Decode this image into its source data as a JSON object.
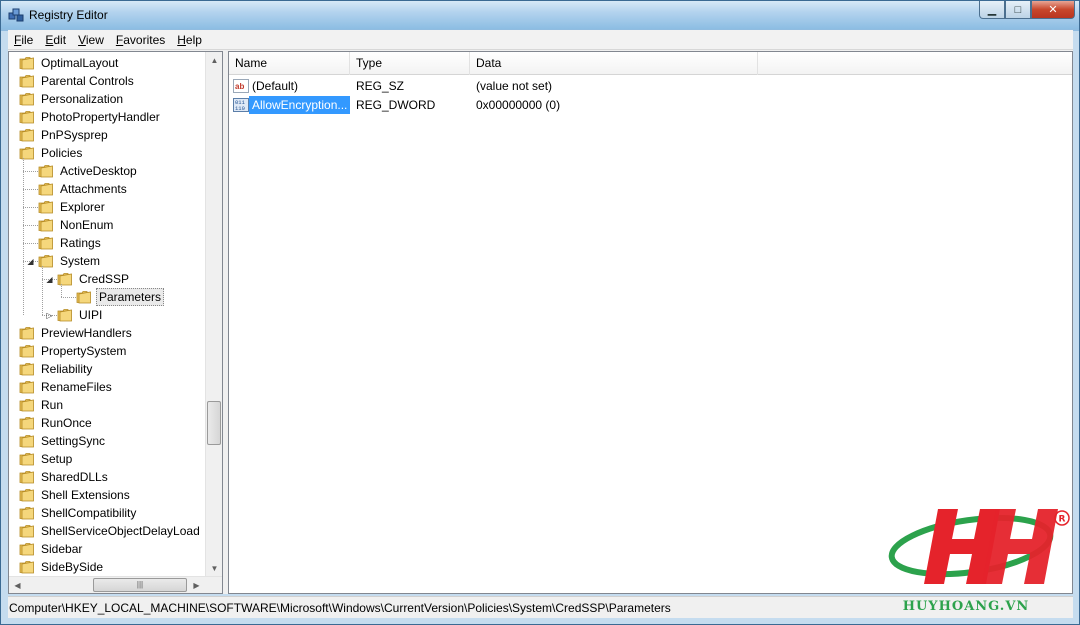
{
  "window": {
    "title": "Registry Editor"
  },
  "menu": [
    "File",
    "Edit",
    "View",
    "Favorites",
    "Help"
  ],
  "tree": [
    {
      "label": "OptimalLayout",
      "level": 0
    },
    {
      "label": "Parental Controls",
      "level": 0
    },
    {
      "label": "Personalization",
      "level": 0
    },
    {
      "label": "PhotoPropertyHandler",
      "level": 0
    },
    {
      "label": "PnPSysprep",
      "level": 0
    },
    {
      "label": "Policies",
      "level": 0
    },
    {
      "label": "ActiveDesktop",
      "level": 1
    },
    {
      "label": "Attachments",
      "level": 1
    },
    {
      "label": "Explorer",
      "level": 1
    },
    {
      "label": "NonEnum",
      "level": 1
    },
    {
      "label": "Ratings",
      "level": 1
    },
    {
      "label": "System",
      "level": 1,
      "expanded": true
    },
    {
      "label": "CredSSP",
      "level": 2,
      "expanded": true
    },
    {
      "label": "Parameters",
      "level": 3,
      "selected": true
    },
    {
      "label": "UIPI",
      "level": 2,
      "collapsed": true
    },
    {
      "label": "PreviewHandlers",
      "level": 0
    },
    {
      "label": "PropertySystem",
      "level": 0
    },
    {
      "label": "Reliability",
      "level": 0
    },
    {
      "label": "RenameFiles",
      "level": 0
    },
    {
      "label": "Run",
      "level": 0
    },
    {
      "label": "RunOnce",
      "level": 0
    },
    {
      "label": "SettingSync",
      "level": 0
    },
    {
      "label": "Setup",
      "level": 0
    },
    {
      "label": "SharedDLLs",
      "level": 0
    },
    {
      "label": "Shell Extensions",
      "level": 0
    },
    {
      "label": "ShellCompatibility",
      "level": 0
    },
    {
      "label": "ShellServiceObjectDelayLoad",
      "level": 0
    },
    {
      "label": "Sidebar",
      "level": 0
    },
    {
      "label": "SideBySide",
      "level": 0
    }
  ],
  "list": {
    "columns": [
      "Name",
      "Type",
      "Data"
    ],
    "rows": [
      {
        "name": "(Default)",
        "type": "REG_SZ",
        "data": "(value not set)",
        "icon": "string-value-icon"
      },
      {
        "name": "AllowEncryption...",
        "type": "REG_DWORD",
        "data": "0x00000000 (0)",
        "icon": "binary-value-icon",
        "selected": true
      }
    ]
  },
  "status": {
    "path": "Computer\\HKEY_LOCAL_MACHINE\\SOFTWARE\\Microsoft\\Windows\\CurrentVersion\\Policies\\System\\CredSSP\\Parameters"
  },
  "watermark": {
    "text": "HUYHOANG.VN"
  },
  "colors": {
    "selection": "#3399ff",
    "folder": "#e8c15a",
    "logo_red": "#e5232b",
    "logo_green": "#2ca24c"
  }
}
